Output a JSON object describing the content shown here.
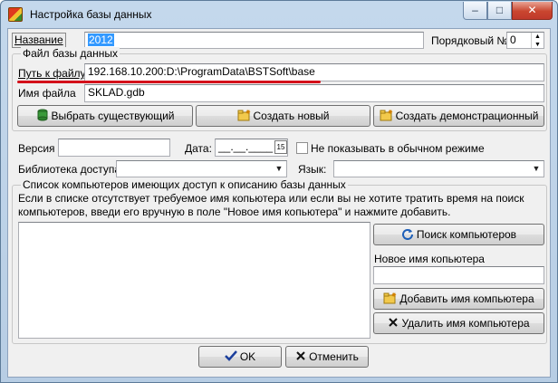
{
  "window": {
    "title": "Настройка базы данных",
    "minimize_glyph": "‒",
    "maximize_glyph": "□",
    "close_glyph": "✕"
  },
  "name_row": {
    "label": "Название",
    "value": "2012",
    "order_label": "Порядковый №",
    "order_value": "0",
    "spin_up": "▲",
    "spin_down": "▼"
  },
  "db_file_group": {
    "caption": "Файл базы данных",
    "path_label": "Путь к файлу",
    "path_value": "192.168.10.200:D:\\ProgramData\\BSTSoft\\base",
    "filename_label": "Имя файла",
    "filename_value": "SKLAD.gdb",
    "btn_select_existing": "Выбрать существующий",
    "btn_create_new": "Создать новый",
    "btn_create_demo": "Создать демонстрационный"
  },
  "version_row": {
    "version_label": "Версия",
    "version_value": "",
    "date_label": "Дата:",
    "date_value": "__.__.____",
    "calendar_icon_text": "15",
    "hide_checkbox_label": "Не показывать в обычном режиме"
  },
  "library_row": {
    "library_label": "Библиотека доступа",
    "library_value": "",
    "language_label": "Язык:",
    "language_value": "",
    "dropdown_glyph": "▼"
  },
  "computers_group": {
    "caption": "Список компьютеров имеющих доступ к описанию базы данных",
    "hint": "Если в списке отсутствует требуемое имя копьютера или если вы не хотите тратить время на поиск компьютеров, введи его вручную в поле \"Новое имя копьютера\" и нажмите добавить.",
    "btn_search": "Поиск компьютеров",
    "new_name_label": "Новое имя копьютера",
    "new_name_value": "",
    "btn_add": "Добавить имя компьютера",
    "btn_delete": "Удалить имя компьютера"
  },
  "footer": {
    "ok": "OK",
    "cancel": "Отменить"
  },
  "colors": {
    "selection": "#3399ff",
    "annotation_line": "#d4101a",
    "close_button": "#c9462f"
  }
}
